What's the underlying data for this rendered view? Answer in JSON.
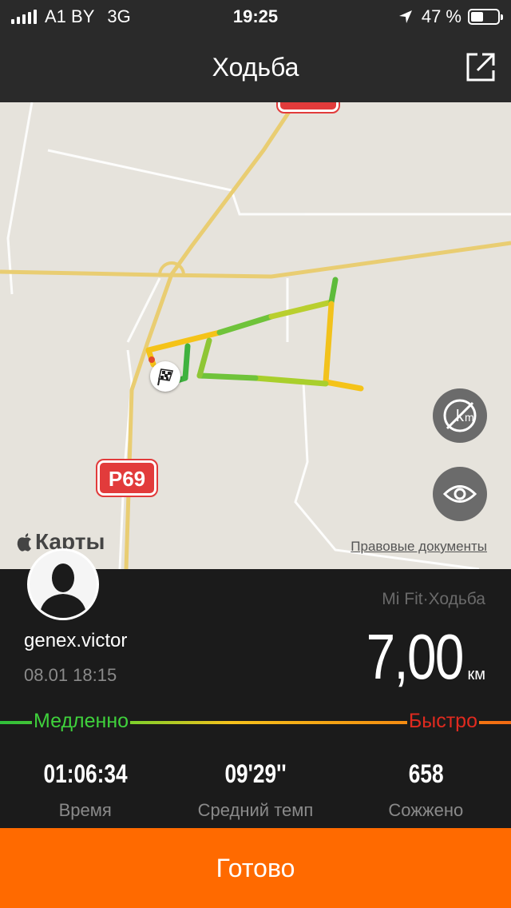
{
  "status_bar": {
    "carrier": "A1 BY",
    "network": "3G",
    "time": "19:25",
    "battery_percent": "47 %",
    "battery_level": 0.47
  },
  "nav": {
    "title": "Ходьба",
    "share_icon": "share-icon"
  },
  "map": {
    "road_labels": [
      "P69"
    ],
    "brand": "Карты",
    "legal_link": "Правовые документы",
    "buttons": [
      "km-markers-toggle-icon",
      "eye-icon"
    ]
  },
  "summary": {
    "username": "genex.victor",
    "datetime": "08.01 18:15",
    "source": "Mi Fit·Ходьба",
    "distance_value": "7,00",
    "distance_unit": "км"
  },
  "speed_legend": {
    "slow": "Медленно",
    "fast": "Быстро",
    "colors": [
      "#2fbf3a",
      "#f6c21c",
      "#f36a12"
    ]
  },
  "stats": [
    {
      "value": "01:06:34",
      "label": "Время"
    },
    {
      "value": "09'29''",
      "label": "Средний темп"
    },
    {
      "value": "658",
      "label": "Сожжено"
    }
  ],
  "done_label": "Готово",
  "colors": {
    "accent": "#ff6a00",
    "shield_red": "#e23b3b",
    "map_bg": "#e6e3dc"
  }
}
